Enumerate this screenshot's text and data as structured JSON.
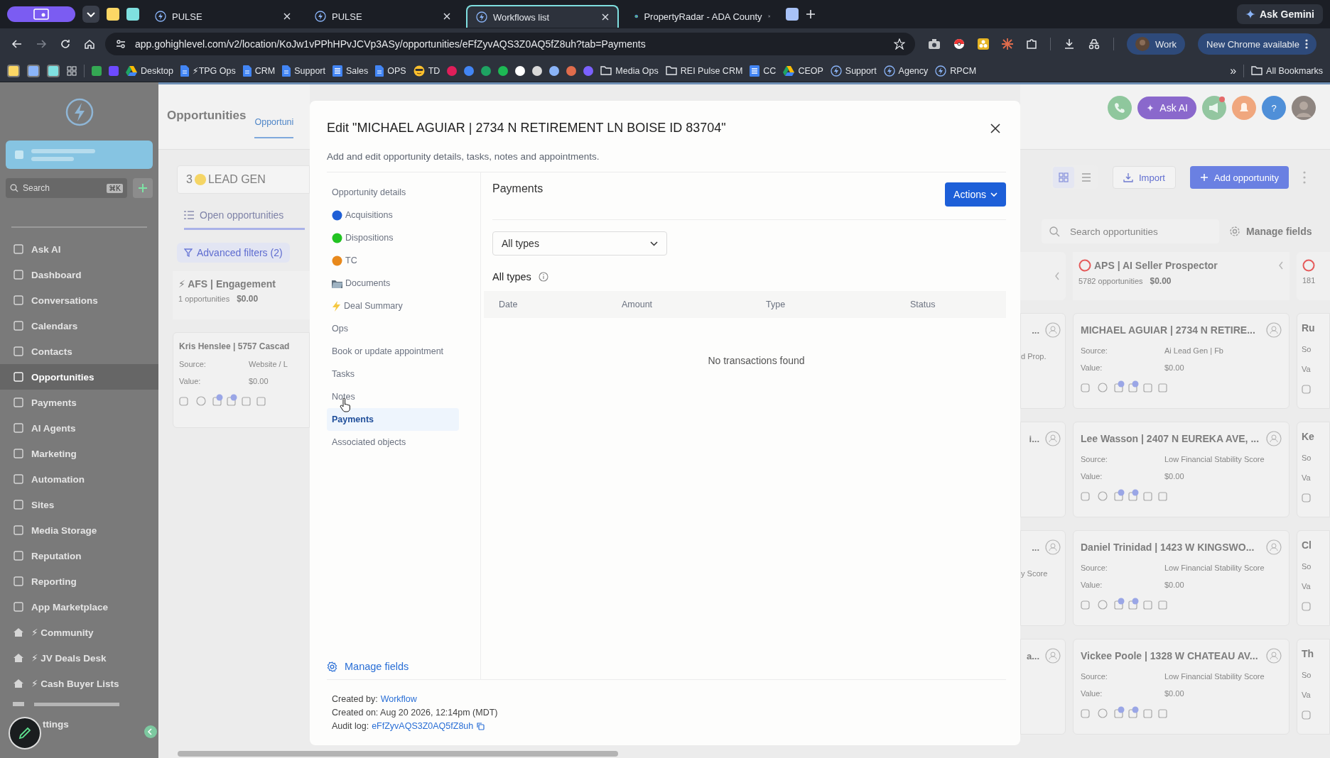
{
  "browser": {
    "tabs": [
      {
        "title": "PULSE",
        "kind": "app",
        "selected": false
      },
      {
        "title": "PULSE",
        "kind": "app",
        "selected": false
      },
      {
        "title": "Workflows list",
        "kind": "app",
        "selected": true
      },
      {
        "title": "PropertyRadar - ADA County",
        "kind": "web",
        "selected": false
      }
    ],
    "gemini": "Ask Gemini",
    "url": "app.gohighlevel.com/v2/location/KoJw1vPPhHPvJCVp3ASy/opportunities/eFfZyvAQS3Z0AQ5fZ8uh?tab=Payments",
    "profile": "Work",
    "update": "New Chrome available",
    "bookmarks_before": [
      {
        "label": "Desktop",
        "kind": "drive"
      },
      {
        "label": "⚡TPG Ops",
        "kind": "doc"
      },
      {
        "label": "CRM",
        "kind": "doc"
      },
      {
        "label": "Support",
        "kind": "doc"
      },
      {
        "label": "Sales",
        "kind": "sheet"
      },
      {
        "label": "OPS",
        "kind": "doc"
      },
      {
        "label": "TD",
        "kind": "emoji"
      }
    ],
    "bookmarks_after": [
      {
        "label": "Media Ops",
        "kind": "folder"
      },
      {
        "label": "REI Pulse CRM",
        "kind": "folder"
      },
      {
        "label": "CC",
        "kind": "sheet"
      },
      {
        "label": "CEOP",
        "kind": "drive"
      },
      {
        "label": "Support",
        "kind": "bolt"
      },
      {
        "label": "Agency",
        "kind": "bolt"
      },
      {
        "label": "RPCM",
        "kind": "bolt"
      }
    ],
    "overflow": "»",
    "all_bookmarks": "All Bookmarks"
  },
  "sidebar": {
    "search": {
      "placeholder": "Search"
    },
    "shortcut": "⌘K",
    "items": [
      {
        "label": "Ask AI",
        "kind": "page",
        "selected": false
      },
      {
        "label": "Dashboard",
        "kind": "page",
        "selected": false
      },
      {
        "label": "Conversations",
        "kind": "page",
        "selected": false
      },
      {
        "label": "Calendars",
        "kind": "page",
        "selected": false
      },
      {
        "label": "Contacts",
        "kind": "page",
        "selected": false
      },
      {
        "label": "Opportunities",
        "kind": "page",
        "selected": true
      },
      {
        "label": "Payments",
        "kind": "page",
        "selected": false
      },
      {
        "label": "AI Agents",
        "kind": "page",
        "selected": false
      },
      {
        "label": "Marketing",
        "kind": "page",
        "selected": false
      },
      {
        "label": "Automation",
        "kind": "page",
        "selected": false
      },
      {
        "label": "Sites",
        "kind": "page",
        "selected": false
      },
      {
        "label": "Media Storage",
        "kind": "page",
        "selected": false
      },
      {
        "label": "Reputation",
        "kind": "page",
        "selected": false
      },
      {
        "label": "Reporting",
        "kind": "page",
        "selected": false
      },
      {
        "label": "App Marketplace",
        "kind": "page",
        "selected": false
      },
      {
        "label": "⚡ Community",
        "kind": "link",
        "selected": false
      },
      {
        "label": "⚡ JV Deals Desk",
        "kind": "link",
        "selected": false
      },
      {
        "label": "⚡ Cash Buyer Lists",
        "kind": "link",
        "selected": false
      }
    ],
    "settings": "ttings"
  },
  "page": {
    "title": "Opportunities",
    "tab": "Opportuni",
    "pipeline": {
      "prefix": "3",
      "label": "LEAD GEN"
    },
    "view_tab": "Open opportunities",
    "filters": "Advanced filters (2)",
    "ask_ai": "Ask AI",
    "help": "?",
    "import": "Import",
    "add": "Add opportunity",
    "search": {
      "placeholder": "Search opportunities"
    },
    "manage_fields": "Manage fields",
    "left_column": {
      "title": "⚡ AFS | Engagement",
      "count": "1 opportunities",
      "total": "$0.00",
      "cards": [
        {
          "name": "Kris Henslee | 5757 Cascad",
          "source_label": "Source:",
          "source": "Website / L",
          "value_label": "Value:",
          "value": "$0.00"
        }
      ]
    },
    "hidden_column_cards": [
      {
        "name": "...",
        "source": "d Prop."
      },
      {
        "name": "i..."
      },
      {
        "name": "...",
        "source": "y Score"
      },
      {
        "name": "a..."
      }
    ],
    "column": {
      "title": "APS | AI Seller Prospector",
      "count": "5782 opportunities",
      "total": "$0.00",
      "cards": [
        {
          "name": "MICHAEL AGUIAR | 2734 N RETIRE...",
          "source_label": "Source:",
          "source": "Ai Lead Gen | Fb",
          "value_label": "Value:",
          "value": "$0.00"
        },
        {
          "name": "Lee Wasson | 2407 N EUREKA AVE, ...",
          "source_label": "Source:",
          "source": "Low Financial Stability Score",
          "value_label": "Value:",
          "value": "$0.00"
        },
        {
          "name": "Daniel Trinidad | 1423 W KINGSWO...",
          "source_label": "Source:",
          "source": "Low Financial Stability Score",
          "value_label": "Value:",
          "value": "$0.00"
        },
        {
          "name": "Vickee Poole | 1328 W CHATEAU AV...",
          "source_label": "Source:",
          "source": "Low Financial Stability Score",
          "value_label": "Value:",
          "value": "$0.00"
        }
      ]
    },
    "cut_column": {
      "count": "181",
      "cards": [
        {
          "name": "Ru",
          "source_label": "So",
          "value_label": "Va"
        },
        {
          "name": "Ke",
          "source_label": "So",
          "value_label": "Va"
        },
        {
          "name": "Cl",
          "source_label": "So",
          "value_label": "Va"
        },
        {
          "name": "Th",
          "source_label": "So",
          "value_label": "Va"
        }
      ]
    }
  },
  "modal": {
    "title": "Edit \"MICHAEL AGUIAR | 2734 N RETIREMENT LN BOISE ID 83704\"",
    "subtitle": "Add and edit opportunity details, tasks, notes and appointments.",
    "nav": [
      {
        "label": "Opportunity details",
        "kind": "plain",
        "selected": false
      },
      {
        "label": "Acquisitions",
        "kind": "dot",
        "color": "#1f5fd6",
        "selected": false
      },
      {
        "label": "Dispositions",
        "kind": "dot",
        "color": "#22c322",
        "selected": false
      },
      {
        "label": "TC",
        "kind": "dot",
        "color": "#e8891c",
        "selected": false
      },
      {
        "label": "Documents",
        "kind": "folder",
        "selected": false
      },
      {
        "label": "Deal Summary",
        "kind": "bolt",
        "selected": false
      },
      {
        "label": "Ops",
        "kind": "plain",
        "selected": false
      },
      {
        "label": "Book or update appointment",
        "kind": "plain",
        "selected": false
      },
      {
        "label": "Tasks",
        "kind": "plain",
        "selected": false
      },
      {
        "label": "Notes",
        "kind": "plain",
        "selected": false
      },
      {
        "label": "Payments",
        "kind": "plain",
        "selected": true
      },
      {
        "label": "Associated objects",
        "kind": "plain",
        "selected": false
      }
    ],
    "manage_fields": "Manage fields",
    "section_title": "Payments",
    "actions": "Actions",
    "filter": {
      "value": "All types"
    },
    "list_title": "All types",
    "columns": [
      "Date",
      "Amount",
      "Type",
      "Status"
    ],
    "empty": "No transactions found",
    "footer": {
      "created_by_label": "Created by:",
      "created_by": "Workflow",
      "created_on": "Created on: Aug 20 2026, 12:14pm (MDT)",
      "audit_label": "Audit log:",
      "audit": "eFfZyvAQS3Z0AQ5fZ8uh"
    }
  }
}
